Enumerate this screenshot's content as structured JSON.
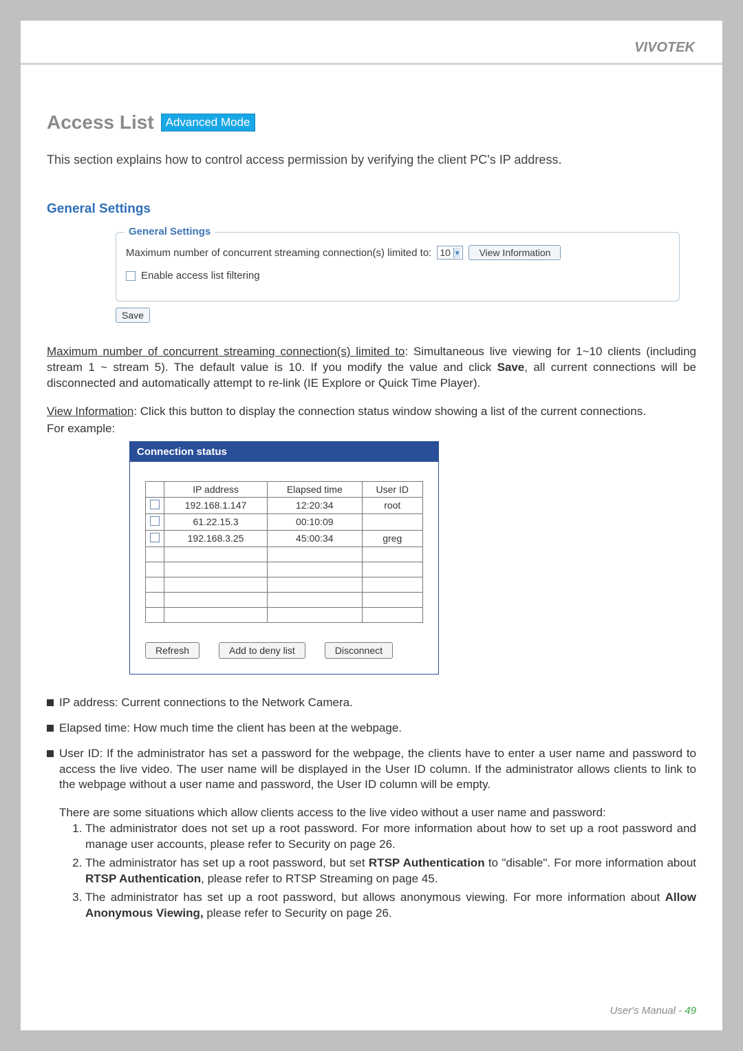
{
  "brand": "VIVOTEK",
  "title": "Access List",
  "badge": "Advanced Mode",
  "intro": "This section explains how to control access permission by verifying the client PC's IP address.",
  "section_general": "General Settings",
  "settings": {
    "legend": "General Settings",
    "max_label": "Maximum number of concurrent streaming connection(s) limited to:",
    "max_value": "10",
    "view_info_btn": "View Information",
    "enable_filter": "Enable access list filtering",
    "save": "Save"
  },
  "para1_lead": "Maximum number of concurrent streaming connection(s) limited to",
  "para1_rest": ": Simultaneous live viewing for 1~10 clients (including stream 1 ~ stream 5). The default value is 10. If you modify the value and click ",
  "para1_bold": "Save",
  "para1_tail": ", all current connections will be disconnected and automatically attempt to re-link (IE Explore or Quick Time Player).",
  "para2_lead": "View Information",
  "para2_rest": ": Click this button to display the connection status window showing a list of the current connections.",
  "para2_eg": "For example:",
  "conn": {
    "title": "Connection status",
    "headers": {
      "ip": "IP address",
      "elapsed": "Elapsed time",
      "user": "User ID"
    },
    "rows": [
      {
        "ip": "192.168.1.147",
        "elapsed": "12:20:34",
        "user": "root"
      },
      {
        "ip": "61.22.15.3",
        "elapsed": "00:10:09",
        "user": ""
      },
      {
        "ip": "192.168.3.25",
        "elapsed": "45:00:34",
        "user": "greg"
      },
      {
        "ip": "",
        "elapsed": "",
        "user": ""
      },
      {
        "ip": "",
        "elapsed": "",
        "user": ""
      },
      {
        "ip": "",
        "elapsed": "",
        "user": ""
      },
      {
        "ip": "",
        "elapsed": "",
        "user": ""
      },
      {
        "ip": "",
        "elapsed": "",
        "user": ""
      }
    ],
    "buttons": {
      "refresh": "Refresh",
      "deny": "Add to deny list",
      "disconnect": "Disconnect"
    }
  },
  "bullets": {
    "ip_lead": "IP address",
    "ip_rest": ": Current connections to the Network Camera.",
    "elapsed_lead": "Elapsed time",
    "elapsed_rest": ": How much time the client has been at the webpage.",
    "user_lead": "User ID",
    "user_rest": ": If the administrator has set a password for the webpage, the clients have to enter a user name and password to access the live video. The user name will be displayed in the User ID column. If  the administrator allows clients to link to the webpage without a user name and password, the User ID column will be empty."
  },
  "situations_intro": "There are some situations which allow clients access to the live video without a user name and password:",
  "situations": [
    {
      "pre": "The administrator does not set up a root password. For more information about how to set up a root password and manage user accounts, please refer to Security on page 26."
    },
    {
      "pre": "The administrator has set up a root password, but set ",
      "b1": "RTSP Authentication",
      "mid": " to \"disable\". For more information about ",
      "b2": "RTSP Authentication",
      "post": ", please refer to RTSP Streaming on page 45."
    },
    {
      "pre": "The administrator has set up a root password, but allows anonymous viewing. For more information about ",
      "b1": "Allow Anonymous Viewing,",
      "post": " please refer to Security on page 26."
    }
  ],
  "footer_label": "User's Manual - ",
  "footer_page": "49"
}
